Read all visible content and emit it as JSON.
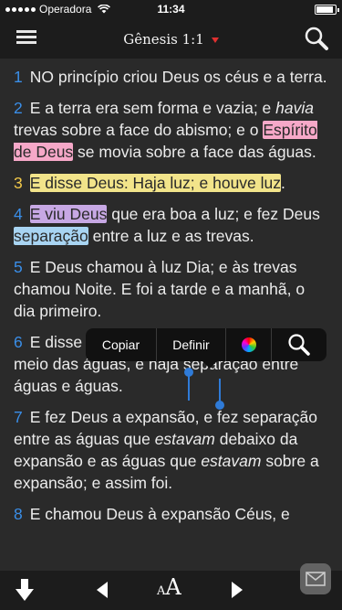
{
  "status_bar": {
    "carrier": "Operadora",
    "time": "11:34"
  },
  "header": {
    "title": "Gênesis 1:1"
  },
  "verses": [
    {
      "num": "1",
      "text": "NO princípio criou Deus os céus e a terra."
    },
    {
      "num": "2",
      "pre": "E a terra era sem forma e vazia; e ",
      "italic": "havia",
      "mid": " trevas sobre a face do abismo; e o ",
      "hl_pink": "Espírito de Deus",
      "post": " se movia sobre a face das águas."
    },
    {
      "num": "3",
      "hl_yellow": "E disse Deus: Haja luz; e houve luz",
      "post": "."
    },
    {
      "num": "4",
      "hl_purple": "E viu Deus",
      "mid": " que era boa a luz; e fez Deus ",
      "hl_blue": "separação",
      "post": " entre a luz e as trevas."
    },
    {
      "num": "5",
      "text": "E Deus chamou à luz Dia; e às trevas chamou Noite. E foi a tarde e a manhã, o dia primeiro."
    },
    {
      "num": "6",
      "pre": "E disse Deus: Haja ",
      "selected": "uma",
      "post": " expansão no meio das águas, e haja separação entre águas e águas."
    },
    {
      "num": "7",
      "pre": "E fez Deus a expansão, e fez separação entre as águas que ",
      "italic1": "estavam",
      "mid": " debaixo da expansão e as águas que ",
      "italic2": "estavam",
      "post": " sobre a expansão; e assim foi."
    },
    {
      "num": "8",
      "text": "E chamou Deus à expansão Céus, e"
    }
  ],
  "popup": {
    "copy": "Copiar",
    "define": "Definir"
  },
  "toolbar": {
    "font_small": "A",
    "font_big": "A"
  },
  "colors": {
    "verse_number": "#3a8ee8",
    "pink": "#f6a8c8",
    "yellow": "#f2e48a",
    "purple": "#c7a8e4",
    "blue": "#a8d4f2"
  }
}
